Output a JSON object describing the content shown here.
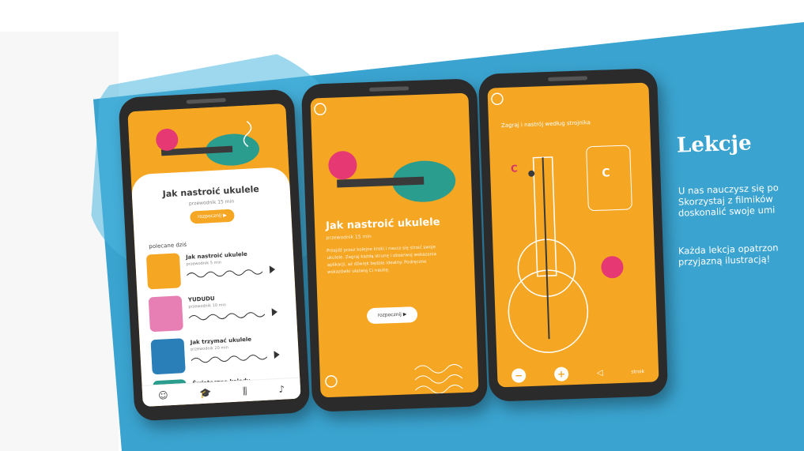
{
  "phone1": {
    "title": "Jak nastroić ukulele",
    "subtitle": "przewodnik 15 min",
    "button_label": "rozpocznij ▶",
    "section_label": "polecane dziś",
    "lessons": [
      {
        "title": "Jak nastroić ukulele",
        "subtitle": "przewodnik 5 min"
      },
      {
        "title": "YUDUDU",
        "subtitle": "przewodnik 10 min"
      },
      {
        "title": "Jak trzymać ukulele",
        "subtitle": "przewodnik 20 min"
      },
      {
        "title": "Świąteczne kolędy",
        "subtitle": ""
      }
    ],
    "nav": [
      "☺",
      "🎓",
      "⫼",
      "♪"
    ]
  },
  "phone2": {
    "title": "Jak nastroić ukulele",
    "subtitle": "przewodnik 15 min",
    "body": "Przejdź przez kolejne kroki i naucz się stroić swoje ukulele. Zagraj każdą strunę i obserwuj wskazania aplikacji, aż dźwięk będzie idealny. Podręczne wskazówki ułatwią Ci naukę.",
    "button_label": "rozpocznij ▶"
  },
  "phone3": {
    "heading": "Zagraj i nastrój według strojnika",
    "chord_left": "C",
    "chord_box": "C",
    "footer_label": "stroik"
  },
  "panel": {
    "title": "Lekcje",
    "lines1": [
      "U nas nauczysz się po",
      "Skorzystaj z filmików",
      "doskonalić swoje umi"
    ],
    "lines2": [
      "Każda lekcja opatrzon",
      "przyjazną ilustracją!"
    ]
  }
}
